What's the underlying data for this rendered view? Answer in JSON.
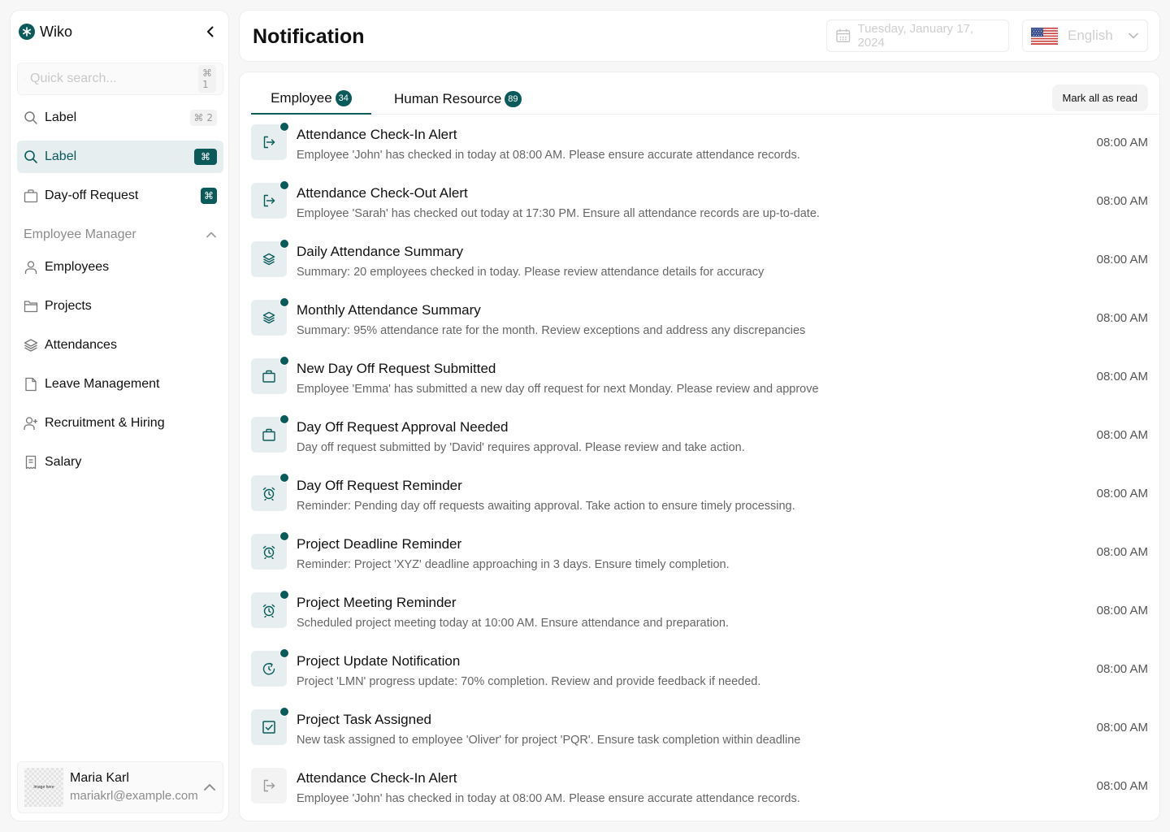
{
  "app": {
    "name": "Wiko",
    "logo_icon": "asterisk-icon"
  },
  "sidebar": {
    "search": {
      "placeholder": "Quick search...",
      "value": "",
      "shortcut": "⌘ 1"
    },
    "items": [
      {
        "label": "Label",
        "icon": "search-icon",
        "shortcut": "⌘ 2",
        "active": false
      },
      {
        "label": "Label",
        "icon": "search-icon",
        "shortcut": "⌘",
        "active": true
      },
      {
        "label": "Day-off Request",
        "icon": "bag-icon",
        "shortcut": "⌘",
        "active": false
      }
    ],
    "section": {
      "title": "Employee Manager",
      "expanded": true,
      "items": [
        {
          "label": "Employees",
          "icon": "user-icon"
        },
        {
          "label": "Projects",
          "icon": "folder-icon"
        },
        {
          "label": "Attendances",
          "icon": "layers-icon"
        },
        {
          "label": "Leave Management",
          "icon": "file-icon"
        },
        {
          "label": "Recruitment & Hiring",
          "icon": "user-plus-icon"
        },
        {
          "label": "Salary",
          "icon": "receipt-icon"
        }
      ]
    },
    "user": {
      "name": "Maria Karl",
      "email": "mariakrl@example.com",
      "avatar_placeholder": "Image here"
    }
  },
  "header": {
    "title": "Notification",
    "date": "Tuesday, January 17, 2024",
    "language": "English"
  },
  "tabs": [
    {
      "label": "Employee",
      "count": "34",
      "active": true
    },
    {
      "label": "Human Resource",
      "count": "89",
      "active": false
    }
  ],
  "mark_all_label": "Mark all as read",
  "colors": {
    "accent": "#0b5a5a",
    "accent_light": "#e6eeef"
  },
  "notifications": [
    {
      "title": "Attendance Check-In Alert",
      "desc": "Employee 'John' has checked in today at 08:00 AM. Please ensure accurate attendance records.",
      "time": "08:00 AM",
      "icon": "login-icon",
      "unread": true
    },
    {
      "title": "Attendance Check-Out Alert",
      "desc": "Employee 'Sarah' has checked out today at 17:30 PM. Ensure all attendance records are up-to-date.",
      "time": "08:00 AM",
      "icon": "login-icon",
      "unread": true
    },
    {
      "title": "Daily Attendance Summary",
      "desc": "Summary: 20 employees checked in today. Please review attendance details for accuracy",
      "time": "08:00 AM",
      "icon": "layers-icon",
      "unread": true
    },
    {
      "title": "Monthly Attendance Summary",
      "desc": "Summary: 95% attendance rate for the month. Review exceptions and address any discrepancies",
      "time": "08:00 AM",
      "icon": "layers-icon",
      "unread": true
    },
    {
      "title": "New Day Off Request Submitted",
      "desc": "Employee 'Emma' has submitted a new day off request for next Monday. Please review and approve",
      "time": "08:00 AM",
      "icon": "bag-icon",
      "unread": true
    },
    {
      "title": "Day Off Request Approval Needed",
      "desc": "Day off request submitted by 'David' requires approval. Please review and take action.",
      "time": "08:00 AM",
      "icon": "bag-icon",
      "unread": true
    },
    {
      "title": "Day Off Request Reminder",
      "desc": "Reminder: Pending day off requests awaiting approval. Take action to ensure timely processing.",
      "time": "08:00 AM",
      "icon": "alarm-icon",
      "unread": true
    },
    {
      "title": "Project Deadline Reminder",
      "desc": "Reminder: Project 'XYZ' deadline approaching in 3 days. Ensure timely completion.",
      "time": "08:00 AM",
      "icon": "alarm-icon",
      "unread": true
    },
    {
      "title": "Project Meeting Reminder",
      "desc": "Scheduled project meeting today at 10:00 AM. Ensure attendance and preparation.",
      "time": "08:00 AM",
      "icon": "alarm-icon",
      "unread": true
    },
    {
      "title": "Project Update Notification",
      "desc": "Project 'LMN' progress update: 70% completion. Review and provide feedback if needed.",
      "time": "08:00 AM",
      "icon": "refresh-clock-icon",
      "unread": true
    },
    {
      "title": "Project Task Assigned",
      "desc": "New task assigned to employee 'Oliver' for project 'PQR'. Ensure task completion within deadline",
      "time": "08:00 AM",
      "icon": "checkbox-icon",
      "unread": true
    },
    {
      "title": "Attendance Check-In Alert",
      "desc": "Employee 'John' has checked in today at 08:00 AM. Please ensure accurate attendance records.",
      "time": "08:00 AM",
      "icon": "login-icon",
      "unread": false
    }
  ]
}
